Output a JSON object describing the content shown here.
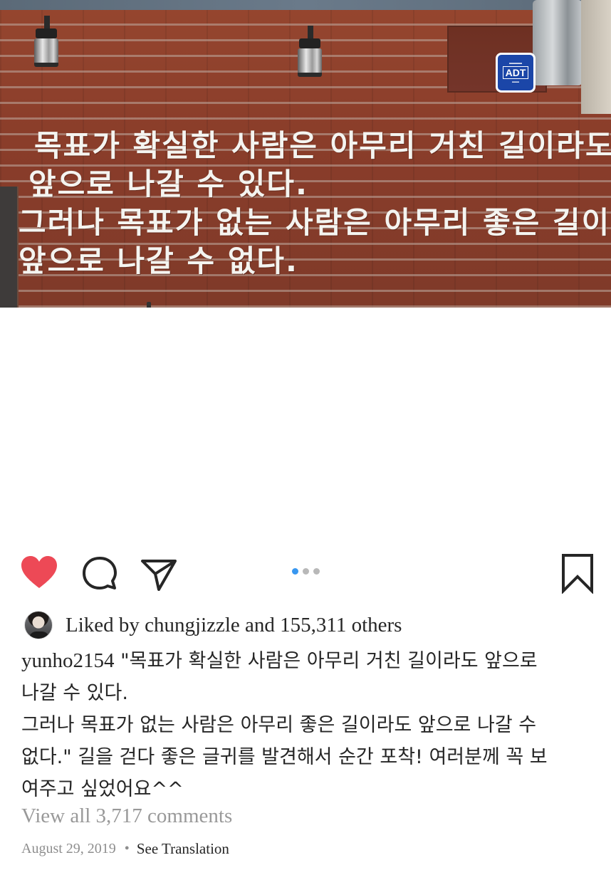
{
  "photo": {
    "wall_text_lines": [
      "목표가 확실한 사람은 아무리 거친 길이라도",
      "앞으로 나갈 수 있다.",
      "그러나 목표가 없는 사람은 아무리 좋은 길이라",
      "앞으로 나갈 수 없다."
    ],
    "sign": {
      "logo": "ADT"
    }
  },
  "actions": {
    "liked": true,
    "like_color": "#ed4956",
    "carousel_total": 3,
    "carousel_active": 1,
    "carousel_active_color": "#3897f0"
  },
  "likes": {
    "text": "Liked by chungjizzle and 155,311 others"
  },
  "caption": {
    "username": "yunho2154",
    "line1_text": " \"목표가 확실한 사람은 아무리 거친 길이라도 앞으로",
    "line2": "나갈 수 있다.",
    "line3": "그러나 목표가 없는 사람은 아무리 좋은 길이라도 앞으로 나갈 수",
    "line4": "없다.\" 길을 걷다 좋은 글귀를 발견해서 순간 포착! 여러분께 꼭 보",
    "line5": "여주고 싶었어요^^"
  },
  "comments": {
    "view_all": "View all 3,717 comments"
  },
  "meta": {
    "date": "August 29, 2019",
    "separator": "•",
    "translate": "See Translation"
  }
}
